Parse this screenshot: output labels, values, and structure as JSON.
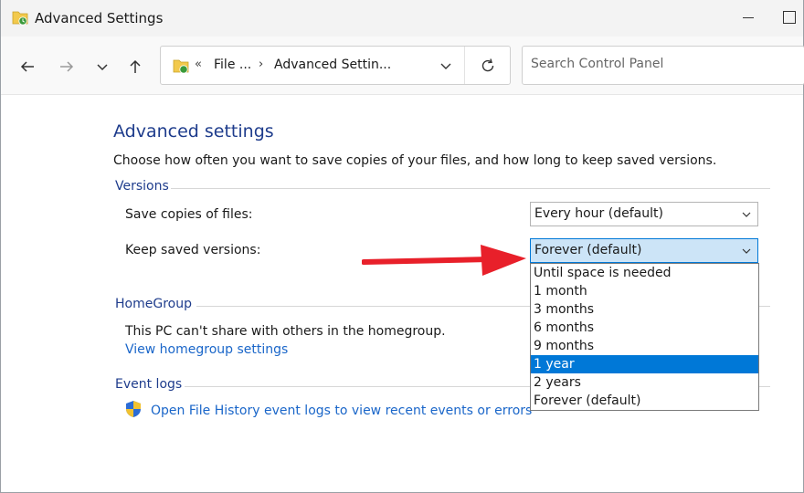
{
  "window": {
    "title": "Advanced Settings"
  },
  "address": {
    "chevrons": "«",
    "crumb1": "File ...",
    "separator": "›",
    "crumb2": "Advanced Settin..."
  },
  "search": {
    "placeholder": "Search Control Panel",
    "value": ""
  },
  "page": {
    "heading": "Advanced settings",
    "description": "Choose how often you want to save copies of your files, and how long to keep saved versions."
  },
  "versions": {
    "label": "Versions",
    "save_copies_label": "Save copies of files:",
    "save_copies_value": "Every hour (default)",
    "keep_versions_label": "Keep saved versions:",
    "keep_versions_value": "Forever (default)",
    "options": [
      "Until space is needed",
      "1 month",
      "3 months",
      "6 months",
      "9 months",
      "1 year",
      "2 years",
      "Forever (default)"
    ],
    "highlighted_option": "1 year"
  },
  "homegroup": {
    "label": "HomeGroup",
    "status": "This PC can't share with others in the homegroup.",
    "link": "View homegroup settings"
  },
  "eventlogs": {
    "label": "Event logs",
    "link": "Open File History event logs to view recent events or errors"
  },
  "colors": {
    "accent": "#0078d7",
    "heading": "#1e3c8c",
    "link": "#1a66c9",
    "annotation_arrow": "#e8202a"
  }
}
